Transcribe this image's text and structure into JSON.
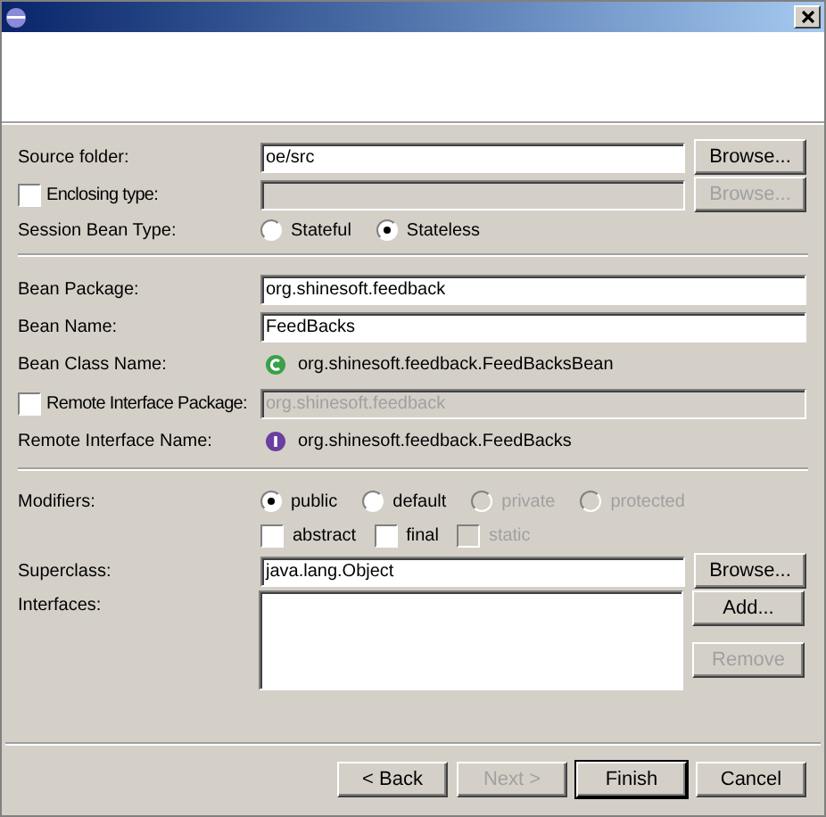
{
  "sections": [
    [
      {
        "kind": "field",
        "label": "Source folder:",
        "value": "oe/src",
        "disabled": false,
        "button": {
          "label": "Browse...",
          "disabled": false
        }
      },
      {
        "kind": "field",
        "label": "Enclosing type:",
        "checkbox": {
          "checked": false
        },
        "disabled": true,
        "button": {
          "label": "Browse...",
          "disabled": true
        }
      },
      {
        "kind": "radios",
        "label": "Session Bean Type:",
        "options": [
          {
            "label": "Stateful",
            "selected": false,
            "disabled": false
          },
          {
            "label": "Stateless",
            "selected": true,
            "disabled": false
          }
        ]
      }
    ],
    [
      {
        "kind": "field",
        "label": "Bean Package:",
        "value": "org.shinesoft.feedback",
        "disabled": false
      },
      {
        "kind": "field",
        "label": "Bean Name:",
        "value": "FeedBacks",
        "disabled": false
      },
      {
        "kind": "class",
        "label": "Bean Class Name:",
        "value": "org.shinesoft.feedback.FeedBacksBean"
      },
      {
        "kind": "field",
        "label": "Remote Interface Package:",
        "checkbox": {
          "checked": false
        },
        "value": "org.shinesoft.feedback",
        "disabled": true
      },
      {
        "kind": "interface",
        "label": "Remote Interface Name:",
        "value": "org.shinesoft.feedback.FeedBacks"
      }
    ],
    [
      {
        "kind": "radios",
        "label": "Modifiers:",
        "options": [
          {
            "label": "public",
            "selected": true,
            "disabled": false
          },
          {
            "label": "default",
            "selected": false,
            "disabled": false
          },
          {
            "label": "private",
            "selected": false,
            "disabled": true
          },
          {
            "label": "protected",
            "selected": false,
            "disabled": true
          }
        ]
      },
      {
        "kind": "checks",
        "options": [
          {
            "label": "abstract",
            "checked": false,
            "disabled": false
          },
          {
            "label": "final",
            "checked": false,
            "disabled": false
          },
          {
            "label": "static",
            "checked": false,
            "disabled": true
          }
        ]
      },
      {
        "kind": "field",
        "label": "Superclass:",
        "value": "java.lang.Object",
        "disabled": false,
        "button": {
          "label": "Browse...",
          "disabled": false
        }
      },
      {
        "kind": "list",
        "label": "Interfaces:",
        "buttons": [
          {
            "label": "Add...",
            "disabled": false
          },
          {
            "label": "Remove",
            "disabled": true
          }
        ]
      }
    ]
  ],
  "footer": [
    {
      "label": "< Back",
      "disabled": false,
      "default": false
    },
    {
      "label": "Next >",
      "disabled": true,
      "default": false
    },
    {
      "label": "Finish",
      "disabled": false,
      "default": true
    },
    {
      "label": "Cancel",
      "disabled": false,
      "default": false
    }
  ]
}
